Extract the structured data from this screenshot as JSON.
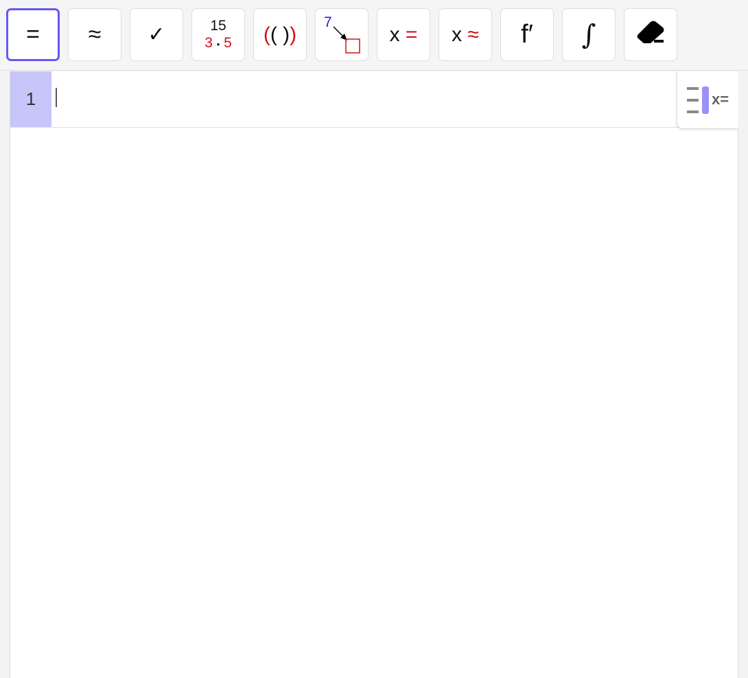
{
  "toolbar": {
    "evaluate": "=",
    "numeric": "≈",
    "keep_input": "✓",
    "factor_top": "15",
    "factor_a": "3",
    "factor_dot": "•",
    "factor_b": "5",
    "expand_outer_l": "(",
    "expand_inner": "( )",
    "expand_outer_r": ")",
    "substitute_num": "7",
    "solve_x": "x",
    "solve_eq": "=",
    "nsolve_x": "x",
    "nsolve_eq": "≈",
    "derivative": "f′",
    "integral": "∫"
  },
  "cas": {
    "rows": [
      {
        "number": "1",
        "input": ""
      }
    ]
  },
  "stylebar": {
    "label": "x="
  },
  "colors": {
    "accent": "#6557f5",
    "row_highlight": "#c8c5fb",
    "red": "#d0101c"
  }
}
